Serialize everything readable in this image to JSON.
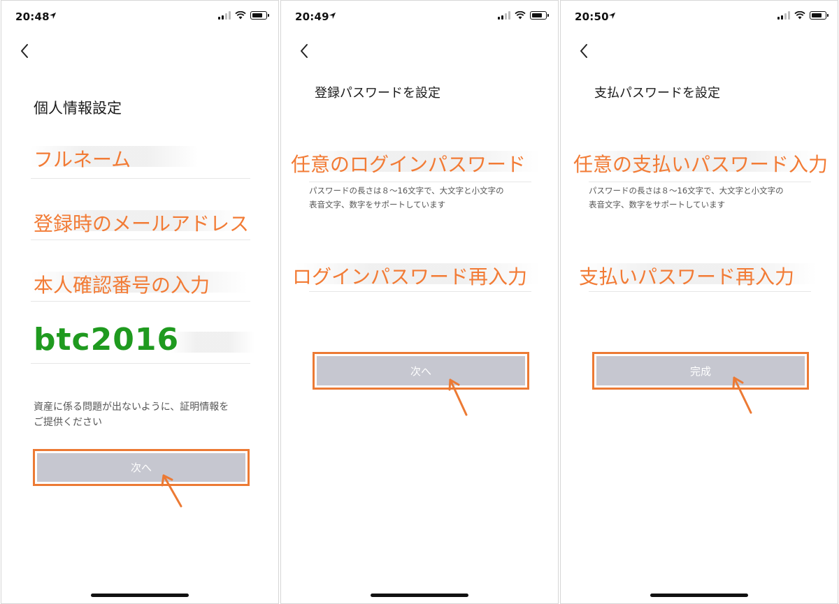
{
  "colors": {
    "annotation_orange": "#f27b35",
    "annotation_green": "#1f9a1f",
    "button_gray": "#c6c7d0",
    "button_outline": "#ec7a34"
  },
  "screens": [
    {
      "status": {
        "time": "20:48",
        "icons": [
          "location-icon",
          "signal-icon",
          "wifi-icon",
          "battery-icon"
        ]
      },
      "title": "個人情報設定",
      "fields": [
        {
          "label": "フルネーム"
        },
        {
          "label": "登録時のメールアドレス"
        },
        {
          "label": "本人確認番号の入力"
        },
        {
          "label": "btc2016"
        }
      ],
      "hint_line1": "資産に係る問題が出ないように、証明情報を",
      "hint_line2": "ご提供ください",
      "button_label": "次へ"
    },
    {
      "status": {
        "time": "20:49",
        "icons": [
          "location-icon",
          "signal-icon",
          "wifi-icon",
          "battery-icon"
        ]
      },
      "title": "登録パスワードを設定",
      "fields": [
        {
          "label": "任意のログインパスワード"
        },
        {
          "label": "ログインパスワード再入力"
        }
      ],
      "hint_line1": "パスワードの長さは８～16文字で、大文字と小文字の",
      "hint_line2": "表音文字、数字をサポートしています",
      "button_label": "次へ"
    },
    {
      "status": {
        "time": "20:50",
        "icons": [
          "location-icon",
          "signal-icon",
          "wifi-icon",
          "battery-icon"
        ]
      },
      "title": "支払パスワードを設定",
      "fields": [
        {
          "label": "任意の支払いパスワード入力"
        },
        {
          "label": "支払いパスワード再入力"
        }
      ],
      "hint_line1": "パスワードの長さは８～16文字で、大文字と小文字の",
      "hint_line2": "表音文字、数字をサポートしています",
      "button_label": "完成"
    }
  ]
}
